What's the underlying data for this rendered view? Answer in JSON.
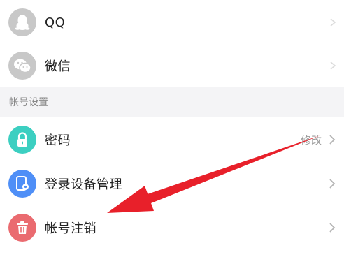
{
  "bound_accounts": [
    {
      "label": "QQ",
      "icon": "qq-penguin-icon"
    },
    {
      "label": "微信",
      "icon": "wechat-icon"
    }
  ],
  "section": {
    "title": "帐号设置"
  },
  "settings": [
    {
      "label": "密码",
      "right_text": "修改",
      "icon": "lock-icon",
      "color": "#3ccfc1"
    },
    {
      "label": "登录设备管理",
      "right_text": "",
      "icon": "device-manage-icon",
      "color": "#4f8ff7"
    },
    {
      "label": "帐号注销",
      "right_text": "",
      "icon": "trash-icon",
      "color": "#ea6b70"
    }
  ],
  "colors": {
    "gray_icon": "#c8c8c8",
    "annotation_arrow": "#e8202a",
    "section_bg": "#f4f4f6"
  }
}
